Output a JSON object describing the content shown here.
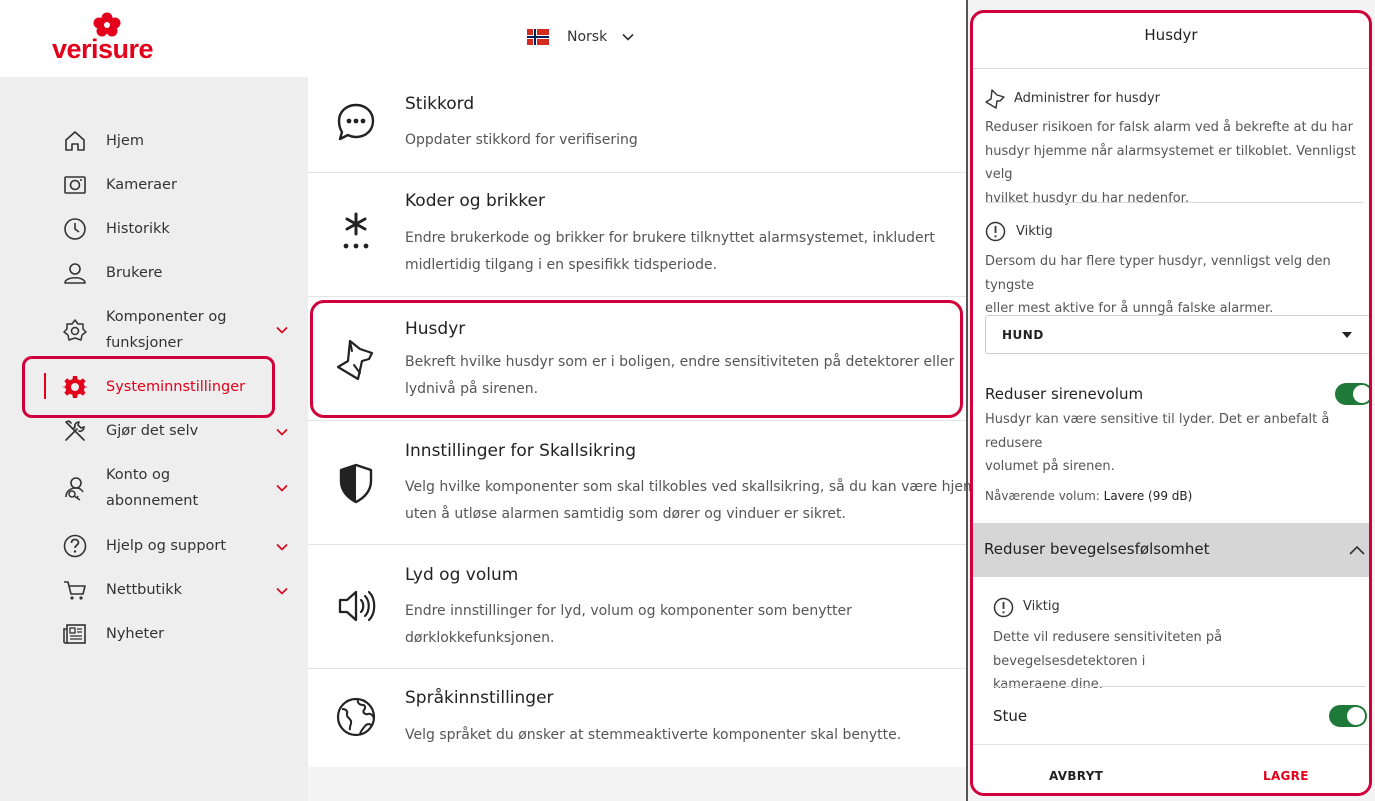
{
  "brand": {
    "logo_text": "verisure",
    "accent_color": "#e2001a",
    "toggle_color": "#1f7a3a"
  },
  "header": {
    "language_label": "Norsk",
    "flag_icon": "norway-flag-icon"
  },
  "sidebar": {
    "items": [
      {
        "label": "Hjem",
        "icon": "home-icon"
      },
      {
        "label": "Kameraer",
        "icon": "camera-icon"
      },
      {
        "label": "Historikk",
        "icon": "clock-icon"
      },
      {
        "label": "Brukere",
        "icon": "users-icon"
      },
      {
        "label_line1": "Komponenter og",
        "label_line2": "funksjoner",
        "icon": "components-icon"
      },
      {
        "label": "Systeminnstillinger",
        "icon": "gear-icon",
        "active": true
      },
      {
        "label": "Gjør det selv",
        "icon": "tools-icon"
      },
      {
        "label_line1": "Konto og",
        "label_line2": "abonnement",
        "icon": "account-icon"
      },
      {
        "label": "Hjelp og support",
        "icon": "help-icon"
      },
      {
        "label": "Nettbutikk",
        "icon": "cart-icon"
      },
      {
        "label": "Nyheter",
        "icon": "news-icon"
      }
    ]
  },
  "settings": [
    {
      "title": "Stikkord",
      "desc": [
        "Oppdater stikkord for verifisering"
      ]
    },
    {
      "title": "Koder og brikker",
      "desc": [
        "Endre brukerkode og brikker for brukere tilknyttet alarmsystemet, inkludert",
        "midlertidig tilgang i en spesifikk tidsperiode."
      ]
    },
    {
      "title": "Husdyr",
      "desc": [
        "Bekreft hvilke husdyr som er i boligen, endre sensitiviteten på detektorer eller",
        "lydnivå på sirenen."
      ]
    },
    {
      "title": "Innstillinger for Skallsikring",
      "desc": [
        "Velg hvilke komponenter som skal tilkobles ved skallsikring, så du kan være hjemme",
        "uten å utløse alarmen samtidig som dører og vinduer er sikret."
      ]
    },
    {
      "title": "Lyd og volum",
      "desc": [
        "Endre innstillinger for lyd, volum og komponenter som benytter",
        "dørklokkefunksjonen."
      ]
    },
    {
      "title": "Språkinnstillinger",
      "desc": [
        "Velg språket du ønsker at stemmeaktiverte komponenter skal benytte."
      ]
    }
  ],
  "panel": {
    "title": "Husdyr",
    "manage_label": "Administrer for husdyr",
    "manage_text": [
      "Reduser risikoen for falsk alarm ved å bekrefte at du har",
      "husdyr hjemme når alarmsystemet er tilkoblet. Vennligst velg",
      "hvilket husdyr du har nedenfor."
    ],
    "important_label": "Viktig",
    "important_text": [
      "Dersom du har flere typer husdyr, vennligst velg den tyngste",
      "eller mest aktive for å unngå falske alarmer."
    ],
    "pet_select_value": "HUND",
    "siren_label": "Reduser sirenevolum",
    "siren_text": [
      "Husdyr kan være sensitive til lyder. Det er anbefalt å redusere",
      "volumet på sirenen."
    ],
    "volume_prefix": "Nåværende volum:",
    "volume_value": "Lavere (99 dB)",
    "motion_label": "Reduser bevegelsesfølsomhet",
    "motion_important_label": "Viktig",
    "motion_text": [
      "Dette vil redusere sensitiviteten på bevegelsesdetektoren i",
      "kameraene dine."
    ],
    "room_label": "Stue",
    "cancel_label": "AVBRYT",
    "save_label": "LAGRE"
  }
}
